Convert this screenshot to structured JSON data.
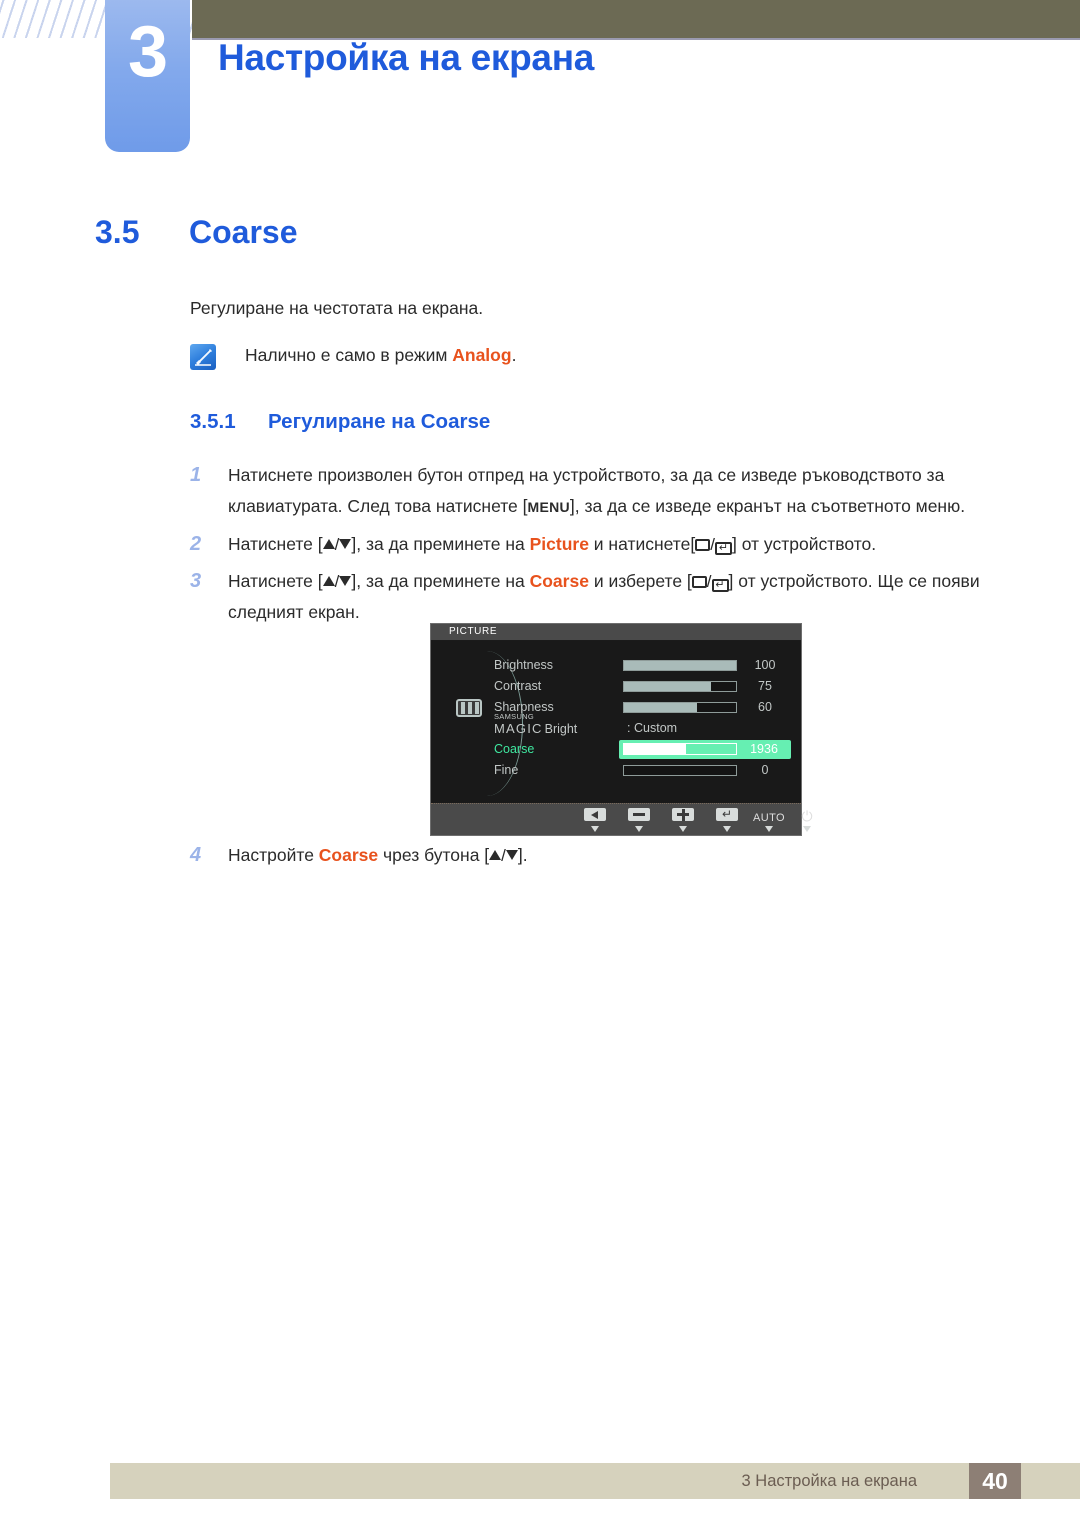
{
  "header": {
    "chapter_number": "3",
    "chapter_title": "Настройка на екрана"
  },
  "section": {
    "number": "3.5",
    "title": "Coarse",
    "intro": "Регулиране на честотата на екрана."
  },
  "note": {
    "icon": "note-pen-icon",
    "text_before": "Налично е само в режим ",
    "accent": "Analog",
    "text_after": "."
  },
  "subsection": {
    "number": "3.5.1",
    "title": "Регулиране на Coarse"
  },
  "steps": [
    {
      "number": "1",
      "part1": "Натиснете произволен бутон отпред на устройството, за да се изведе ръководството за клавиатурата. След това натиснете [",
      "key": "MENU",
      "part2": "], за да се изведе екранът на съответното меню."
    },
    {
      "number": "2",
      "part1": "Натиснете [",
      "keys_updown": "▲/▼",
      "part2": "], за да преминете на ",
      "accent": "Picture",
      "part3": " и натиснете[",
      "keys_enter": "□/↵",
      "part4": "] от устройството."
    },
    {
      "number": "3",
      "part1": "Натиснете [",
      "keys_updown": "▲/▼",
      "part2": "], за да преминете на ",
      "accent": "Coarse",
      "part3": " и изберете [",
      "keys_enter": "□/↵",
      "part4": "] от устройството. Ще се появи следният екран."
    },
    {
      "number": "4",
      "part1": "Настройте ",
      "accent": "Coarse",
      "part2": " чрез бутона [",
      "keys_updown": "▲/▼",
      "part3": "]."
    }
  ],
  "osd": {
    "title": "PICTURE",
    "category_icon": "picture-bars-icon",
    "rows": [
      {
        "label": "Brightness",
        "type": "slider",
        "value": "100",
        "fill_pct": 100
      },
      {
        "label": "Contrast",
        "type": "slider",
        "value": "75",
        "fill_pct": 78
      },
      {
        "label": "Sharpness",
        "type": "slider",
        "value": "60",
        "fill_pct": 65
      },
      {
        "label_top": "SAMSUNG",
        "label_main": "MAGIC",
        "label_suffix": "Bright",
        "type": "text",
        "value": "Custom"
      },
      {
        "label": "Coarse",
        "type": "slider",
        "value": "1936",
        "fill_pct": 55,
        "selected": true
      },
      {
        "label": "Fine",
        "type": "slider",
        "value": "0",
        "fill_pct": 0
      }
    ],
    "buttons": [
      {
        "name": "back-button",
        "glyph": "left-triangle"
      },
      {
        "name": "minus-button",
        "glyph": "minus"
      },
      {
        "name": "plus-button",
        "glyph": "plus"
      },
      {
        "name": "enter-button",
        "glyph": "return-arrow"
      },
      {
        "name": "auto-button",
        "glyph": "text",
        "label": "AUTO"
      },
      {
        "name": "power-button",
        "glyph": "power"
      }
    ],
    "colors": {
      "highlight": "#66efb2",
      "selected_label": "#3fe8a0",
      "background": "#191919",
      "titlebar": "#4a4a4a"
    }
  },
  "footer": {
    "text": "3 Настройка на екрана",
    "page": "40"
  },
  "colors": {
    "heading_blue": "#1f5bdb",
    "accent_orange": "#e8521d",
    "header_olive": "#6c6a54",
    "footer_beige": "#d6d2bd",
    "footer_page_brown": "#8d7f75"
  }
}
